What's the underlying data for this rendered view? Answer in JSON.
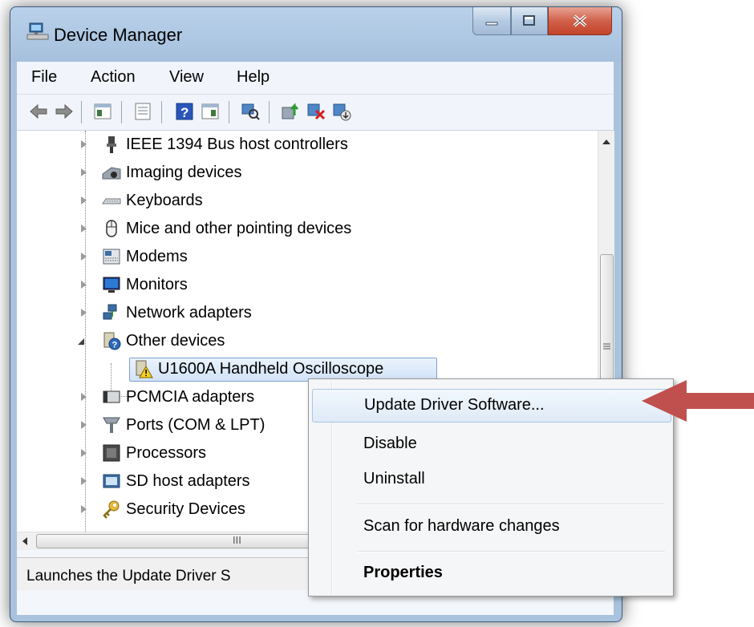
{
  "window": {
    "title": "Device Manager",
    "controls": {
      "minimize": "minimize",
      "maximize": "maximize",
      "close": "close"
    }
  },
  "menubar": [
    "File",
    "Action",
    "View",
    "Help"
  ],
  "toolbar": {
    "icons": [
      "back-icon",
      "forward-icon",
      "show-hide-console-tree-icon",
      "properties-icon",
      "help-icon",
      "show-action-pane-icon",
      "scan-hardware-icon",
      "update-driver-icon",
      "uninstall-icon",
      "enable-device-icon"
    ]
  },
  "tree": {
    "items": [
      {
        "label": "IEEE 1394 Bus host controllers",
        "icon": "usb-plug-icon",
        "expanded": false
      },
      {
        "label": "Imaging devices",
        "icon": "camera-icon",
        "expanded": false
      },
      {
        "label": "Keyboards",
        "icon": "keyboard-icon",
        "expanded": false
      },
      {
        "label": "Mice and other pointing devices",
        "icon": "mouse-icon",
        "expanded": false
      },
      {
        "label": "Modems",
        "icon": "modem-icon",
        "expanded": false
      },
      {
        "label": "Monitors",
        "icon": "monitor-icon",
        "expanded": false
      },
      {
        "label": "Network adapters",
        "icon": "network-icon",
        "expanded": false
      },
      {
        "label": "Other devices",
        "icon": "unknown-device-icon",
        "expanded": true
      },
      {
        "label": "U1600A Handheld Oscilloscope",
        "icon": "warning-device-icon",
        "child": true,
        "selected": true
      },
      {
        "label": "PCMCIA adapters",
        "icon": "pcmcia-icon",
        "expanded": false
      },
      {
        "label": "Ports (COM & LPT)",
        "icon": "port-icon",
        "expanded": false
      },
      {
        "label": "Processors",
        "icon": "processor-icon",
        "expanded": false
      },
      {
        "label": "SD host adapters",
        "icon": "sd-card-icon",
        "expanded": false
      },
      {
        "label": "Security Devices",
        "icon": "key-icon",
        "expanded": false
      }
    ]
  },
  "hscroll": {
    "grip": "III"
  },
  "statusbar": {
    "text": "Launches the Update Driver S"
  },
  "context_menu": {
    "items": [
      {
        "label": "Update Driver Software...",
        "hover": true
      },
      {
        "label": "Disable"
      },
      {
        "label": "Uninstall"
      },
      {
        "label": "Scan for hardware changes"
      },
      {
        "label": "Properties",
        "bold": true
      }
    ]
  },
  "colors": {
    "arrow": "#c0504d",
    "titlebar": "#b9d1ea",
    "close": "#c3432b"
  }
}
